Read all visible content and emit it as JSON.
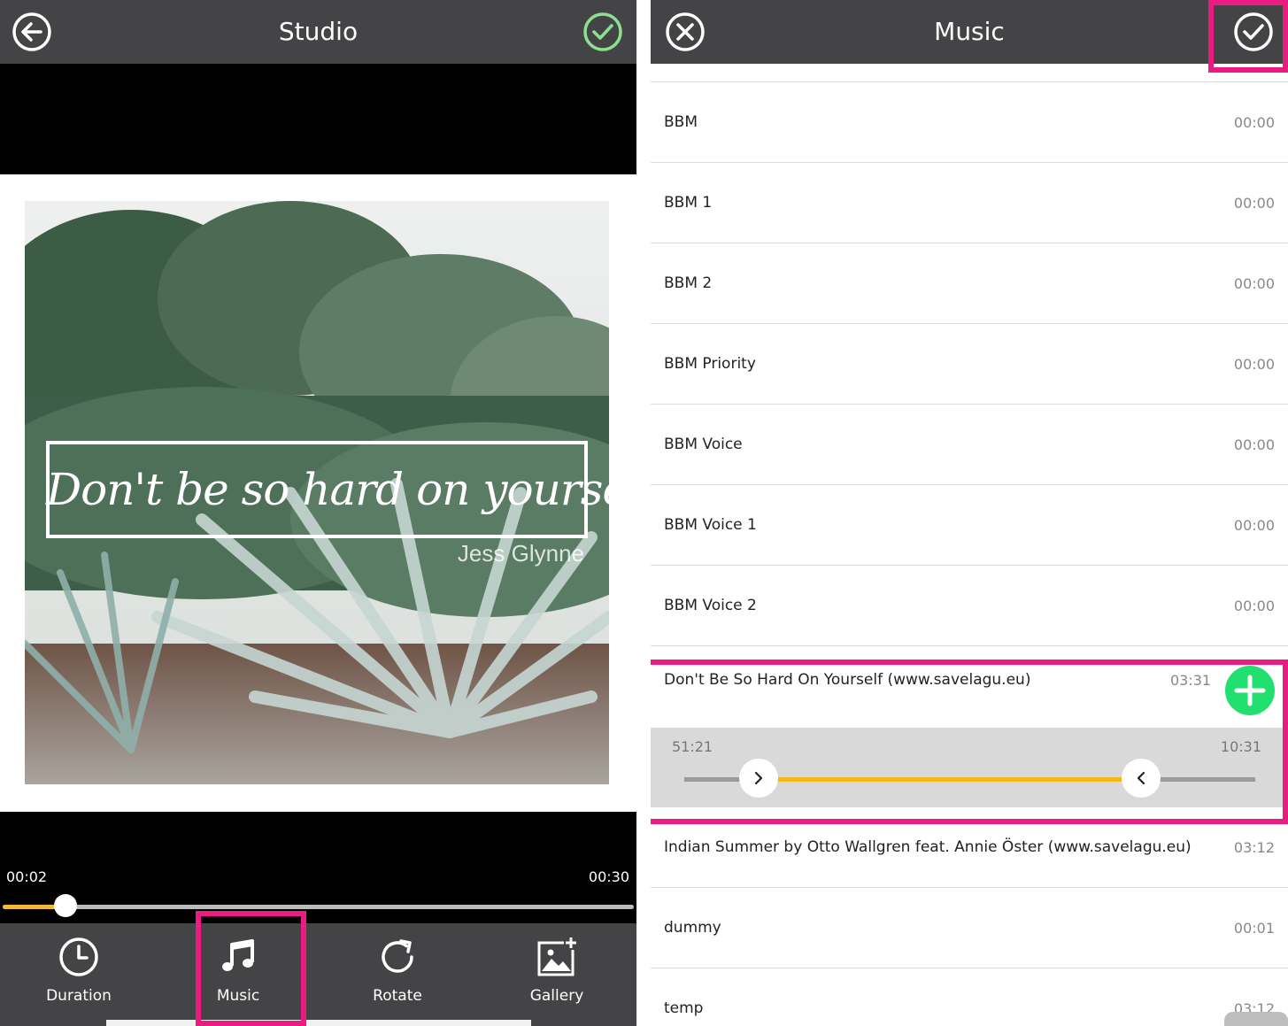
{
  "studio": {
    "title": "Studio",
    "quote": "Don't be so hard on yourself",
    "quote_author": "Jess Glynne",
    "time_current": "00:02",
    "time_total": "00:30",
    "progress_fraction": 0.1,
    "toolbar": [
      {
        "label": "Duration",
        "icon": "clock-icon"
      },
      {
        "label": "Music",
        "icon": "music-note-icon"
      },
      {
        "label": "Rotate",
        "icon": "rotate-icon"
      },
      {
        "label": "Gallery",
        "icon": "gallery-add-icon"
      }
    ],
    "accent_confirm": "#8be28e",
    "highlight_color": "#ec1b82"
  },
  "music": {
    "title": "Music",
    "tracks_before": [
      {
        "name": "BBM",
        "duration": "00:00"
      },
      {
        "name": "BBM 1",
        "duration": "00:00"
      },
      {
        "name": "BBM 2",
        "duration": "00:00"
      },
      {
        "name": "BBM Priority",
        "duration": "00:00"
      },
      {
        "name": "BBM Voice",
        "duration": "00:00"
      },
      {
        "name": "BBM Voice 1",
        "duration": "00:00"
      },
      {
        "name": "BBM Voice 2",
        "duration": "00:00"
      }
    ],
    "selected": {
      "name": "Don't Be So Hard On Yourself (www.savelagu.eu)",
      "duration": "03:31",
      "trim_start": "51:21",
      "trim_end": "10:31",
      "trim_start_fraction": 0.13,
      "trim_end_fraction": 0.8
    },
    "tracks_after": [
      {
        "name": "Indian Summer by Otto Wallgren feat. Annie Öster (www.savelagu.eu)",
        "duration": "03:12"
      },
      {
        "name": "dummy",
        "duration": "00:01"
      },
      {
        "name": "temp",
        "duration": "03:12"
      }
    ],
    "accent_add": "#22e06f",
    "trim_fill_color": "#f5b81b"
  }
}
